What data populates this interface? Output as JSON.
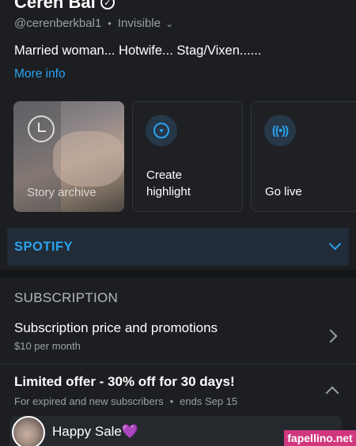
{
  "profile": {
    "name": "Ceren Bal",
    "handle": "@cerenberkbal1",
    "status": "Invisible",
    "bio": "Married woman... Hotwife... Stag/Vixen......",
    "more_info": "More info"
  },
  "cards": [
    {
      "label": "Story archive",
      "icon": "archive-icon"
    },
    {
      "label_line1": "Create",
      "label_line2": "highlight",
      "icon": "highlight-icon"
    },
    {
      "label": "Go live",
      "icon": "live-icon"
    }
  ],
  "spotify": {
    "label": "SPOTIFY",
    "icon": "chevron-down-icon"
  },
  "subscription": {
    "section_title": "SUBSCRIPTION",
    "price_title": "Subscription price and promotions",
    "price_value": "$10 per month"
  },
  "offer": {
    "title": "Limited offer - 30% off for 30 days!",
    "audience": "For expired and new subscribers",
    "ends": "ends Sep 15",
    "promo_label": "Happy Sale",
    "promo_emoji": "💜"
  },
  "watermark": "fapellino.net",
  "colors": {
    "background": "#1c1e22",
    "accent": "#2aa3ef",
    "muted": "#9aa0a8"
  }
}
